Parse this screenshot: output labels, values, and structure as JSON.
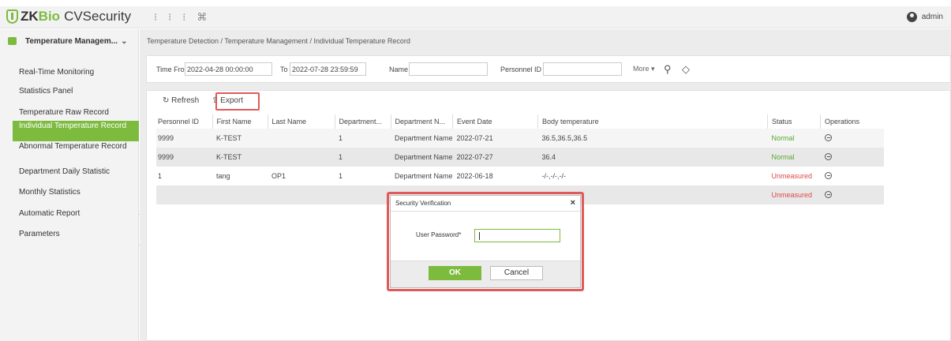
{
  "app": {
    "logo_zk": "ZK",
    "logo_bio": "Bio",
    "logo_rest": "CVSecurity",
    "user": "admin"
  },
  "sidebar": {
    "header": "Temperature Managem...",
    "items": [
      {
        "label": "Real-Time Monitoring"
      },
      {
        "label": "Statistics Panel"
      },
      {
        "label": "Temperature Raw Record"
      },
      {
        "label": "Individual Temperature Record"
      },
      {
        "label": "Abnormal Temperature Record"
      },
      {
        "label": "Department Daily Statistic"
      },
      {
        "label": "Monthly Statistics"
      },
      {
        "label": "Automatic Report"
      },
      {
        "label": "Parameters"
      }
    ],
    "collapse": "<"
  },
  "breadcrumb": "Temperature Detection / Temperature Management / Individual Temperature Record",
  "filter": {
    "time_from_label": "Time From",
    "time_from_value": "2022-04-28 00:00:00",
    "to_label": "To",
    "to_value": "2022-07-28 23:59:59",
    "name_label": "Name",
    "name_value": "",
    "personnel_id_label": "Personnel ID",
    "personnel_id_value": "",
    "more_label": "More",
    "more_caret": "▾"
  },
  "toolbar": {
    "refresh_label": "Refresh",
    "export_label": "Export"
  },
  "table": {
    "columns": [
      "Personnel ID",
      "First Name",
      "Last Name",
      "Department...",
      "Department N...",
      "Event Date",
      "Body temperature",
      "Status",
      "Operations"
    ],
    "rows": [
      [
        "9999",
        "K-TEST",
        "",
        "1",
        "Department Name",
        "2022-07-21",
        "36.5,36.5,36.5",
        "Normal"
      ],
      [
        "9999",
        "K-TEST",
        "",
        "1",
        "Department Name",
        "2022-07-27",
        "36.4",
        "Normal"
      ],
      [
        "1",
        "tang",
        "OP1",
        "1",
        "Department Name",
        "2022-06-18",
        "-/-,-/-,-/-",
        "Unmeasured"
      ],
      [
        "",
        "",
        "",
        "",
        "",
        "",
        "",
        "Unmeasured"
      ]
    ]
  },
  "dialog": {
    "title": "Security Verification",
    "close": "×",
    "password_label": "User Password*",
    "password_value": "",
    "ok_label": "OK",
    "cancel_label": "Cancel"
  },
  "colors": {
    "accent": "#7dbb3f",
    "danger": "#e04848",
    "highlight_frame": "#e05a5a"
  }
}
